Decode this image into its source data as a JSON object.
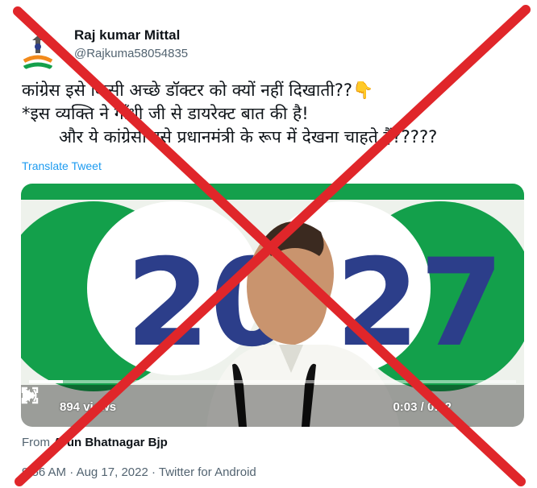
{
  "author": {
    "display_name": "Raj kumar Mittal",
    "handle": "@Rajkuma58054835"
  },
  "tweet": {
    "lines": [
      "कांग्रेस इसे किसी अच्छे डॉक्टर को क्यों नहीं दिखाती??👇",
      "*इस व्यक्ति ने गाँधी जी से डायरेक्ट बात की है!",
      "और ये कांग्रेसी इसे प्रधानमंत्री के रूप में देखना चाहते हैं?????"
    ],
    "translate_label": "Translate Tweet"
  },
  "video": {
    "views": "894 views",
    "time": "0:03 / 0:42",
    "progress": 0.07,
    "backdrop_text_left": "20",
    "backdrop_text_right": "27"
  },
  "source": {
    "prefix": "From",
    "author": "Arun Bhatnagar Bjp"
  },
  "meta": {
    "time": "9:56 AM",
    "separator": "·",
    "date": "Aug 17, 2022",
    "client": "Twitter for Android"
  },
  "colors": {
    "cross_red": "#e0262a",
    "link_blue": "#1d9bf0",
    "muted_gray": "#536471",
    "video_green": "#13a04b",
    "video_navy": "#2c3e8a"
  }
}
